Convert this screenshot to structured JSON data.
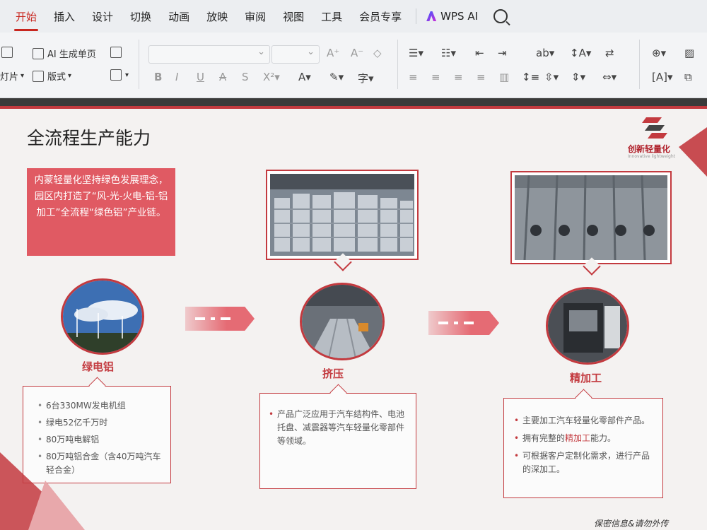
{
  "menubar": {
    "items": [
      "开始",
      "插入",
      "设计",
      "切换",
      "动画",
      "放映",
      "审阅",
      "视图",
      "工具",
      "会员专享"
    ],
    "active_index": 0,
    "wps_ai": "WPS AI"
  },
  "ribbon": {
    "ai_generate": "AI 生成单页",
    "slide_label": "灯片",
    "layout_label": "版式"
  },
  "slide": {
    "title": "全流程生产能力",
    "brand_name": "创新轻量化",
    "brand_sub": "Innovative lightweight",
    "intro_text": "内蒙轻量化坚持绿色发展理念，园区内打造了“风-光-火电-铝-铝加工”全流程“绿色铝”产业链。",
    "stages": [
      {
        "label": "绿电铝",
        "bullets": [
          "6台330MW发电机组",
          "绿电52亿千万时",
          "80万吨电解铝",
          "80万吨铝合金（含40万吨汽车轻合金）"
        ]
      },
      {
        "label": "挤压",
        "bullets": [
          "产品广泛应用于汽车结构件、电池托盘、减震器等汽车轻量化零部件等领域。"
        ]
      },
      {
        "label": "精加工",
        "bullets": [
          "主要加工汽车轻量化零部件产品。",
          "可根据客户定制化需求，进行产品的深加工。"
        ],
        "capability_prefix": "拥有完整的",
        "capability_highlight": "精加工",
        "capability_suffix": "能力。"
      }
    ],
    "footer": "保密信息&请勿外传"
  },
  "colors": {
    "accent": "#c33a3f",
    "intro_bg": "#e05a63",
    "active_tab": "#c8261f"
  }
}
